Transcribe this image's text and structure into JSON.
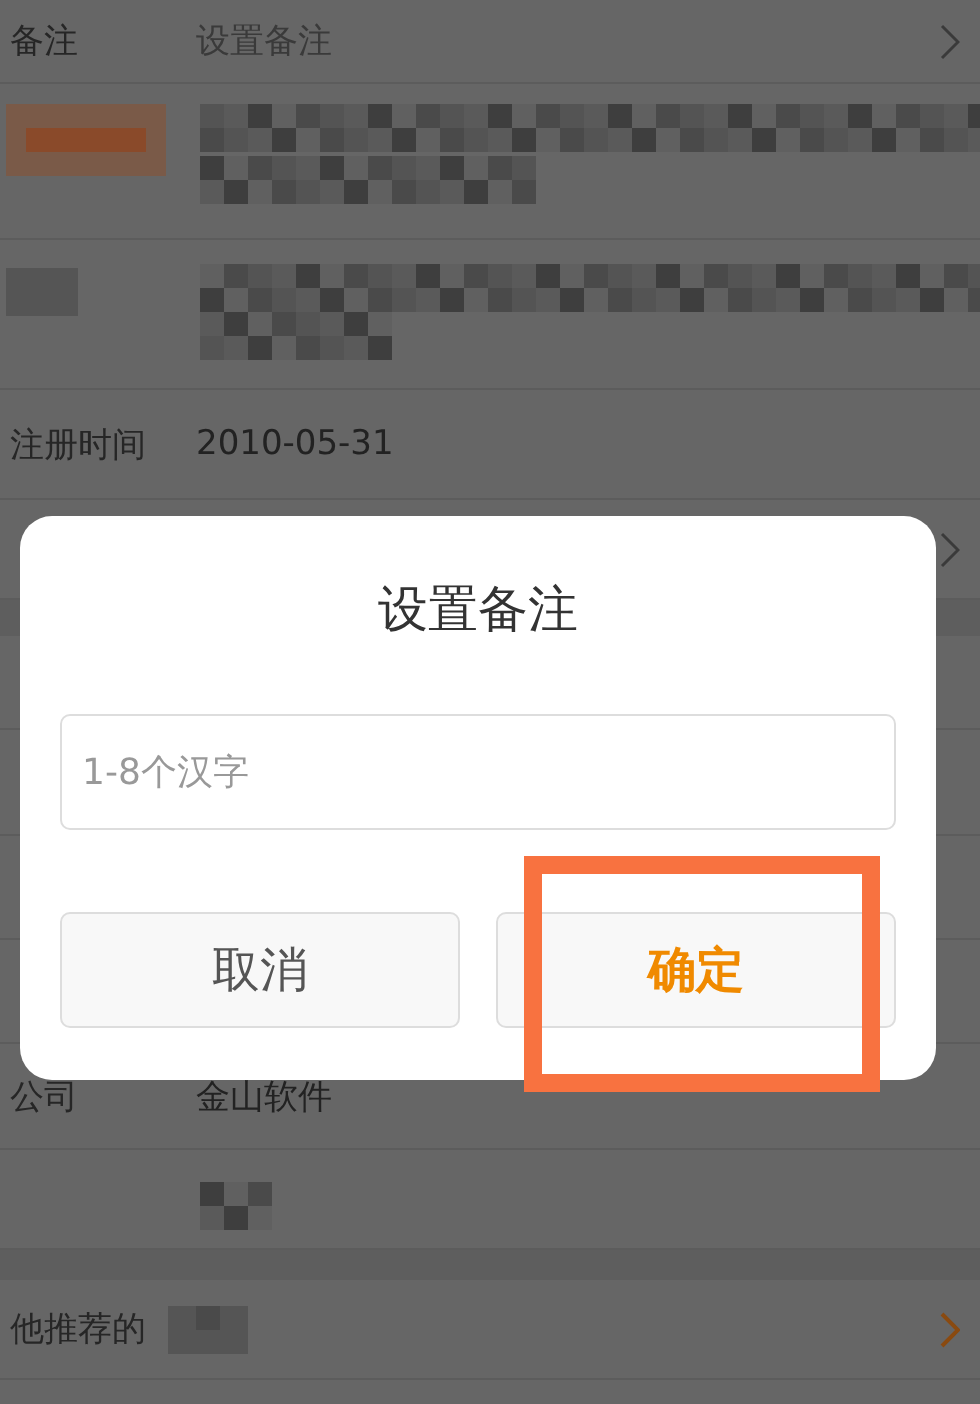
{
  "rows": [
    {
      "kind": "field",
      "label": "备注",
      "placeholder": "设置备注",
      "chevron": true
    },
    {
      "kind": "pixelated"
    },
    {
      "kind": "pixelated"
    },
    {
      "kind": "field",
      "label": "注册时间",
      "value": "2010-05-31",
      "chevron": false
    },
    {
      "kind": "field",
      "chevron": true
    },
    {
      "kind": "gap"
    },
    {
      "kind": "blank"
    },
    {
      "kind": "blank"
    },
    {
      "kind": "blank"
    },
    {
      "kind": "blank"
    },
    {
      "kind": "field",
      "label": "公司",
      "value": "金山软件",
      "chevron": false
    },
    {
      "kind": "pixelated"
    },
    {
      "kind": "gap"
    },
    {
      "kind": "link",
      "label": "他推荐的"
    }
  ],
  "dialog": {
    "title": "设置备注",
    "input": {
      "placeholder": "1-8个汉字"
    },
    "buttons": [
      {
        "label": "取消",
        "primary": false,
        "highlighted": false
      },
      {
        "label": "确定",
        "primary": true,
        "highlighted": true
      }
    ]
  }
}
